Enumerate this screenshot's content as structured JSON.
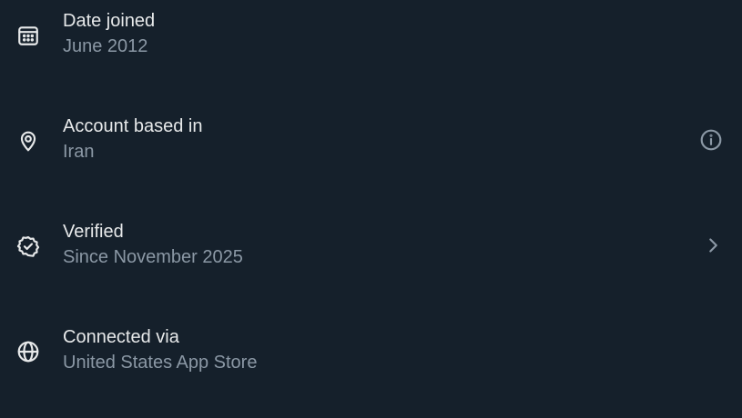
{
  "colors": {
    "background": "#15202b",
    "primary_text": "#e7e9ea",
    "secondary_text": "#8b98a5",
    "icon": "#e7e9ea",
    "trailing_icon": "#8b98a5"
  },
  "rows": [
    {
      "icon": "calendar-icon",
      "title": "Date joined",
      "subtitle": "June 2012"
    },
    {
      "icon": "location-pin-icon",
      "title": "Account based in",
      "subtitle": "Iran",
      "trailing_icon": "info-icon"
    },
    {
      "icon": "verified-badge-icon",
      "title": "Verified",
      "subtitle": "Since November 2025",
      "trailing_icon": "chevron-right-icon"
    },
    {
      "icon": "globe-icon",
      "title": "Connected via",
      "subtitle": "United States App Store"
    }
  ]
}
